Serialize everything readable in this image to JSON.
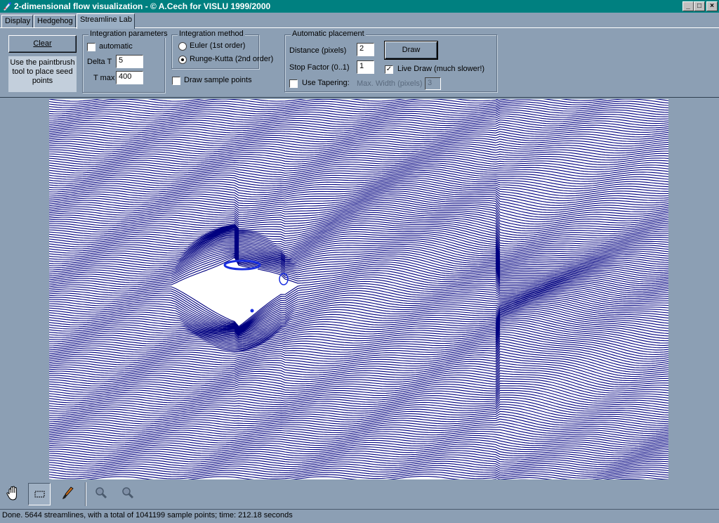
{
  "window": {
    "title": "2-dimensional flow visualization - © A.Cech for VISLU 1999/2000",
    "buttons": {
      "minimize": "_",
      "maximize": "□",
      "close": "×"
    }
  },
  "tabs": [
    {
      "label_pre": "D",
      "label_u": "",
      "label_post": "isplay",
      "text": "Display",
      "active": false
    },
    {
      "text": "Hedgehog",
      "active": false
    },
    {
      "text": "Streamline Lab",
      "active": true
    }
  ],
  "left": {
    "clear_label": "Clear",
    "hint": "Use the paintbrush tool to place seed points"
  },
  "integration_parameters": {
    "title": "Integration parameters",
    "automatic_label": "automatic",
    "automatic_checked": false,
    "delta_t_label": "Delta T",
    "delta_t_value": "5",
    "t_max_label": "T max",
    "t_max_value": "400"
  },
  "integration_method": {
    "title": "Integration method",
    "euler_label": "Euler (1st order)",
    "rk_label": "Runge-Kutta (2nd order)",
    "selected": "rk",
    "draw_sample_label": "Draw sample points",
    "draw_sample_checked": false
  },
  "automatic_placement": {
    "title": "Automatic placement",
    "distance_label": "Distance (pixels)",
    "distance_value": "2",
    "stop_factor_label": "Stop Factor (0..1)",
    "stop_factor_value": "1",
    "use_tapering_label": "Use Tapering:",
    "use_tapering_checked": false,
    "max_width_label": "Max. Width (pixels)",
    "max_width_value": "3",
    "draw_label": "Draw",
    "live_draw_label": "Live Draw (much slower!)",
    "live_draw_checked": true
  },
  "visualization": {
    "line_color": "#000080",
    "background": "#ffffff",
    "obstacle_color": "#ffffff",
    "vortex_color": "#1a2fe0"
  },
  "tools": [
    "hand-icon",
    "rectangle-select-icon",
    "paintbrush-icon",
    "zoom-in-icon",
    "zoom-out-icon"
  ],
  "status": "Done. 5644 streamlines, with a total of 1041199 sample points; time: 212.18 seconds"
}
